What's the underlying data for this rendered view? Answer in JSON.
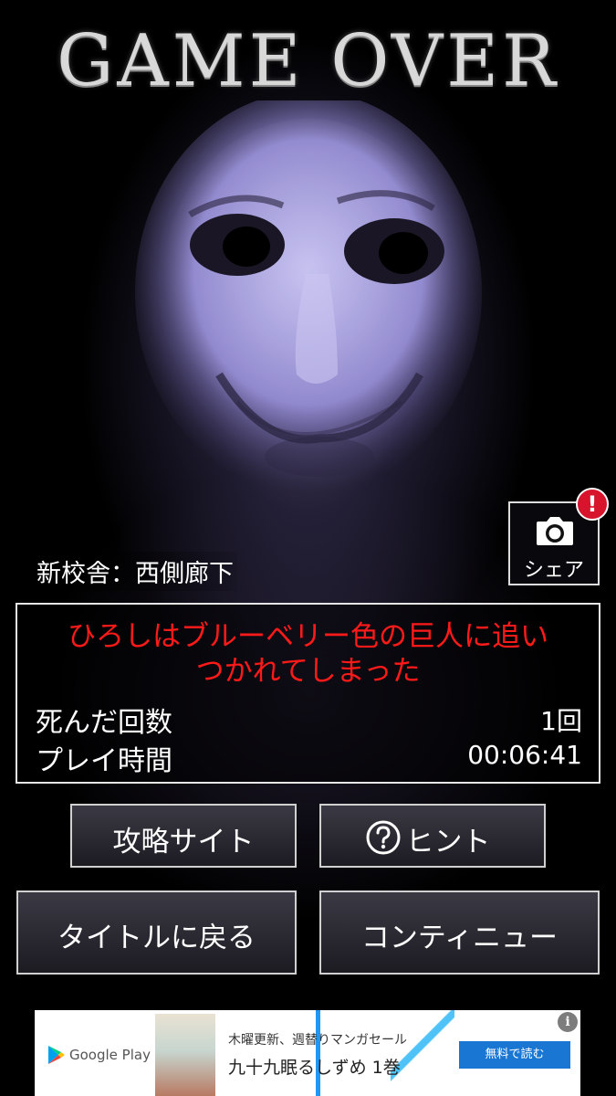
{
  "header": {
    "title": "GAME OVER"
  },
  "location": "新校舎：西側廊下",
  "share": {
    "label": "シェア",
    "badge": "!",
    "camera_icon": "camera-icon"
  },
  "result": {
    "message": "ひろしはブルーベリー色の巨人に追い\nつかれてしまった",
    "death_count_label": "死んだ回数",
    "death_count_value": "1回",
    "play_time_label": "プレイ時間",
    "play_time_value": "00:06:41"
  },
  "buttons": {
    "strategy": "攻略サイト",
    "hint": "ヒント",
    "back_to_title": "タイトルに戻る",
    "continue": "コンティニュー"
  },
  "ad": {
    "store": "Google Play",
    "line1": "木曜更新、週替りマンガセール",
    "line2": "九十九眠るしずめ 1巻",
    "cta": "無料で読む",
    "info": "i"
  },
  "colors": {
    "message": "#ff1a1a",
    "badge": "#d7142b",
    "ad_cta": "#1976d2"
  }
}
